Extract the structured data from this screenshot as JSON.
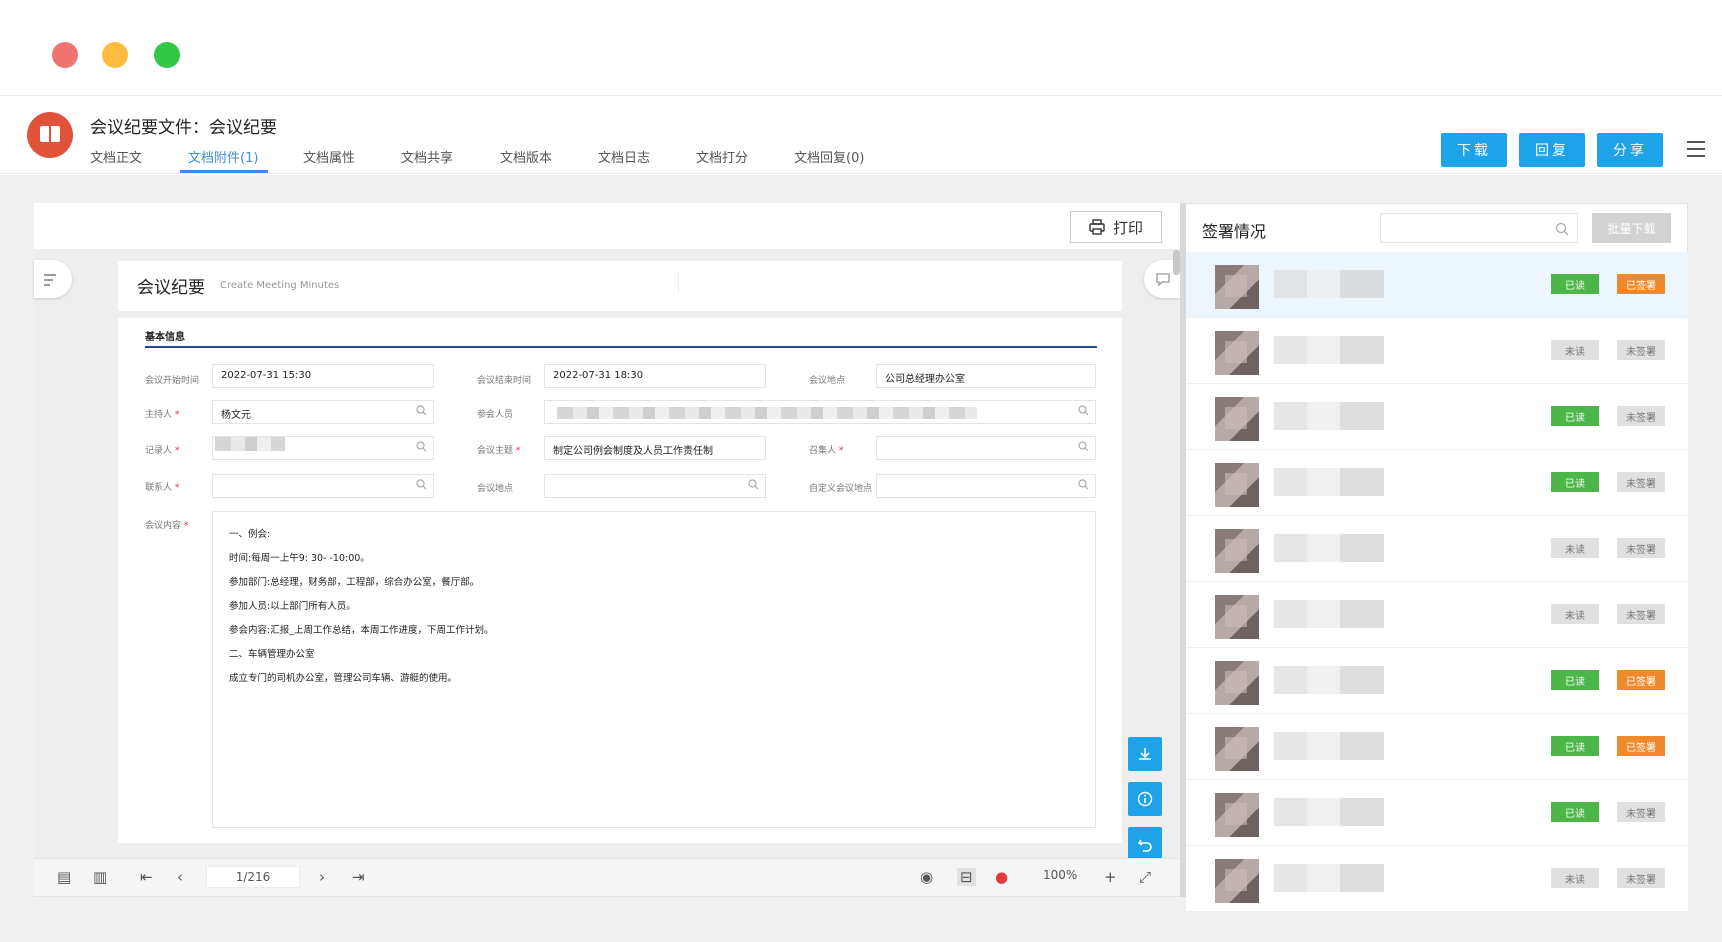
{
  "window": {
    "dot_colors": [
      "#f07472",
      "#fdbc40",
      "#33c748"
    ]
  },
  "header": {
    "doc_title": "会议纪要文件：会议纪要",
    "tabs": [
      {
        "label": "文档正文"
      },
      {
        "label": "文档附件(1)",
        "active": true
      },
      {
        "label": "文档属性"
      },
      {
        "label": "文档共享"
      },
      {
        "label": "文档版本"
      },
      {
        "label": "文档日志"
      },
      {
        "label": "文档打分"
      },
      {
        "label": "文档回复(0)"
      }
    ],
    "buttons": {
      "download": "下载",
      "reply": "回复",
      "share": "分享"
    }
  },
  "viewer": {
    "print_label": "打印",
    "page_title": "会议纪要",
    "page_subtitle": "Create Meeting Minutes",
    "section_title": "基本信息",
    "labels": {
      "start": "会议开始时间",
      "end": "会议结束时间",
      "place": "会议地点",
      "host": "主持人",
      "participants": "参会人员",
      "recorder": "记录人",
      "topic": "会议主题",
      "convener": "召集人",
      "contact": "联系人",
      "room": "会议地点",
      "custom_place": "自定义会议地点",
      "content": "会议内容"
    },
    "values": {
      "start": "2022-07-31   15:30",
      "end": "2022-07-31   18:30",
      "place": "公司总经理办公室",
      "host": "杨文元",
      "topic": "制定公司例会制度及人员工作责任制"
    },
    "content_lines": [
      "一、例会:",
      "时间:每周一上午9: 30- -10:00。",
      "参加部门:总经理，财务部，工程部，综合办公室，餐厅部。",
      "参加人员:以上部门所有人员。",
      "参会内容:汇报_上周工作总结，本周工作进度，下周工作计划。",
      "二、车辆管理办公室",
      "成立专门的司机办公室，管理公司车辆、游艇的使用。"
    ],
    "page_indicator": "1/216",
    "zoom": "100%"
  },
  "signing": {
    "title": "签署情况",
    "batch_download": "批量下载",
    "rows": [
      {
        "read": "已读",
        "sign": "已签署",
        "read_done": true,
        "sign_done": true
      },
      {
        "read": "未读",
        "sign": "未签署",
        "read_done": false,
        "sign_done": false
      },
      {
        "read": "已读",
        "sign": "未签署",
        "read_done": true,
        "sign_done": false
      },
      {
        "read": "已读",
        "sign": "未签署",
        "read_done": true,
        "sign_done": false
      },
      {
        "read": "未读",
        "sign": "未签署",
        "read_done": false,
        "sign_done": false
      },
      {
        "read": "未读",
        "sign": "未签署",
        "read_done": false,
        "sign_done": false
      },
      {
        "read": "已读",
        "sign": "已签署",
        "read_done": true,
        "sign_done": true
      },
      {
        "read": "已读",
        "sign": "已签署",
        "read_done": true,
        "sign_done": true
      },
      {
        "read": "已读",
        "sign": "未签署",
        "read_done": true,
        "sign_done": false
      },
      {
        "read": "未读",
        "sign": "未签署",
        "read_done": false,
        "sign_done": false
      }
    ]
  },
  "colors": {
    "accent": "#1ea3e8",
    "tab_active": "#3a8ee6",
    "read_green": "#4cb648",
    "signed_orange": "#ef8a2c"
  }
}
